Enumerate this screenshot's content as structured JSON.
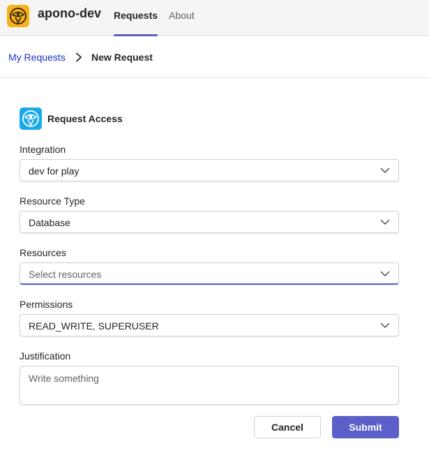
{
  "app": {
    "name": "apono-dev",
    "tabs": [
      {
        "label": "Requests",
        "active": true
      },
      {
        "label": "About",
        "active": false
      }
    ],
    "accent_color": "#5b5fc7",
    "logo_color": "#f7b21b"
  },
  "breadcrumb": {
    "parent": "My Requests",
    "current": "New Request"
  },
  "form": {
    "title": "Request Access",
    "fields": {
      "integration": {
        "label": "Integration",
        "value": "dev for play"
      },
      "resource_type": {
        "label": "Resource Type",
        "value": "Database"
      },
      "resources": {
        "label": "Resources",
        "placeholder": "Select resources"
      },
      "permissions": {
        "label": "Permissions",
        "value": "READ_WRITE, SUPERUSER"
      },
      "justification": {
        "label": "Justification",
        "placeholder": "Write something"
      }
    },
    "buttons": {
      "cancel": "Cancel",
      "submit": "Submit"
    }
  }
}
